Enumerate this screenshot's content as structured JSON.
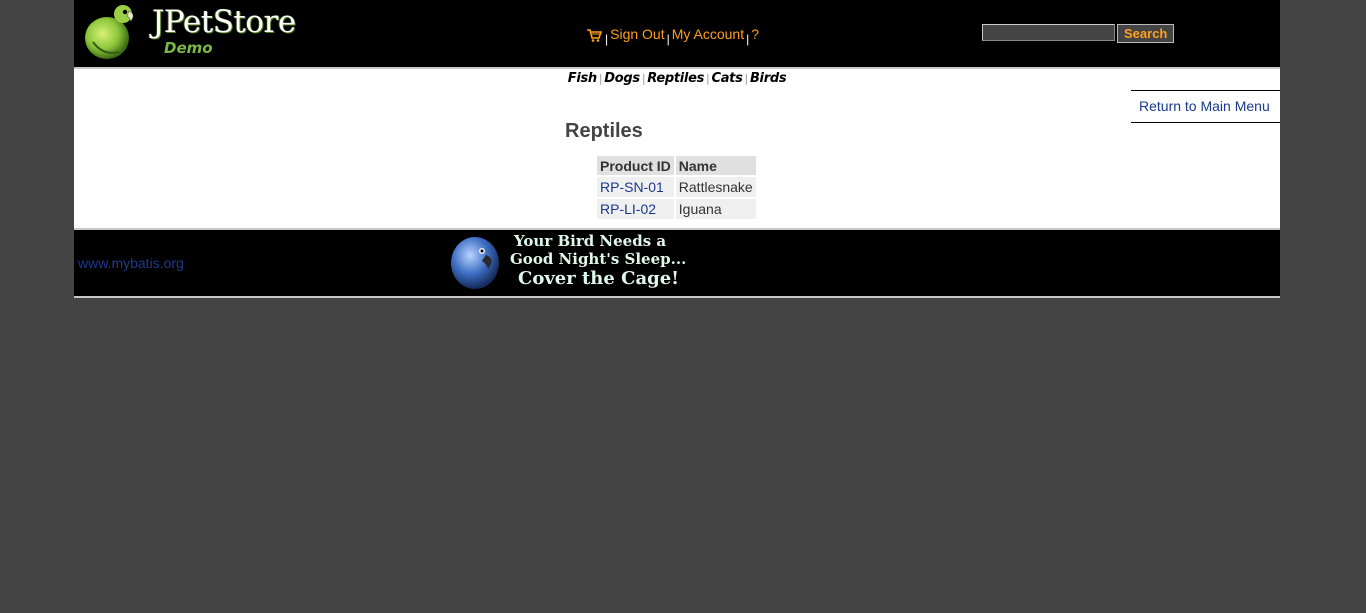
{
  "header": {
    "logo_title": "JPetStore",
    "logo_subtitle": "Demo",
    "menu": {
      "cart_icon": "cart-icon",
      "sign_out": "Sign Out",
      "my_account": "My Account",
      "help": "?",
      "separator": "|"
    },
    "search": {
      "value": "",
      "button_label": "Search"
    }
  },
  "quick_links": {
    "items": [
      "Fish",
      "Dogs",
      "Reptiles",
      "Cats",
      "Birds"
    ],
    "separator": "|"
  },
  "back_link": "Return to Main Menu",
  "page_title": "Reptiles",
  "product_table": {
    "headers": [
      "Product ID",
      "Name"
    ],
    "rows": [
      {
        "product_id": "RP-SN-01",
        "name": "Rattlesnake"
      },
      {
        "product_id": "RP-LI-02",
        "name": "Iguana"
      }
    ]
  },
  "footer": {
    "link": "www.mybatis.org",
    "banner": {
      "line1": "Your Bird Needs a",
      "line2": "Good Night's Sleep...",
      "line3": "Cover the Cage!",
      "icon": "parrot-icon"
    }
  },
  "colors": {
    "page_background": "#444444",
    "header_background": "#000000",
    "menu_link": "#ff9f1c",
    "content_link": "#1a3a8c",
    "logo_accent": "#7ab843"
  }
}
